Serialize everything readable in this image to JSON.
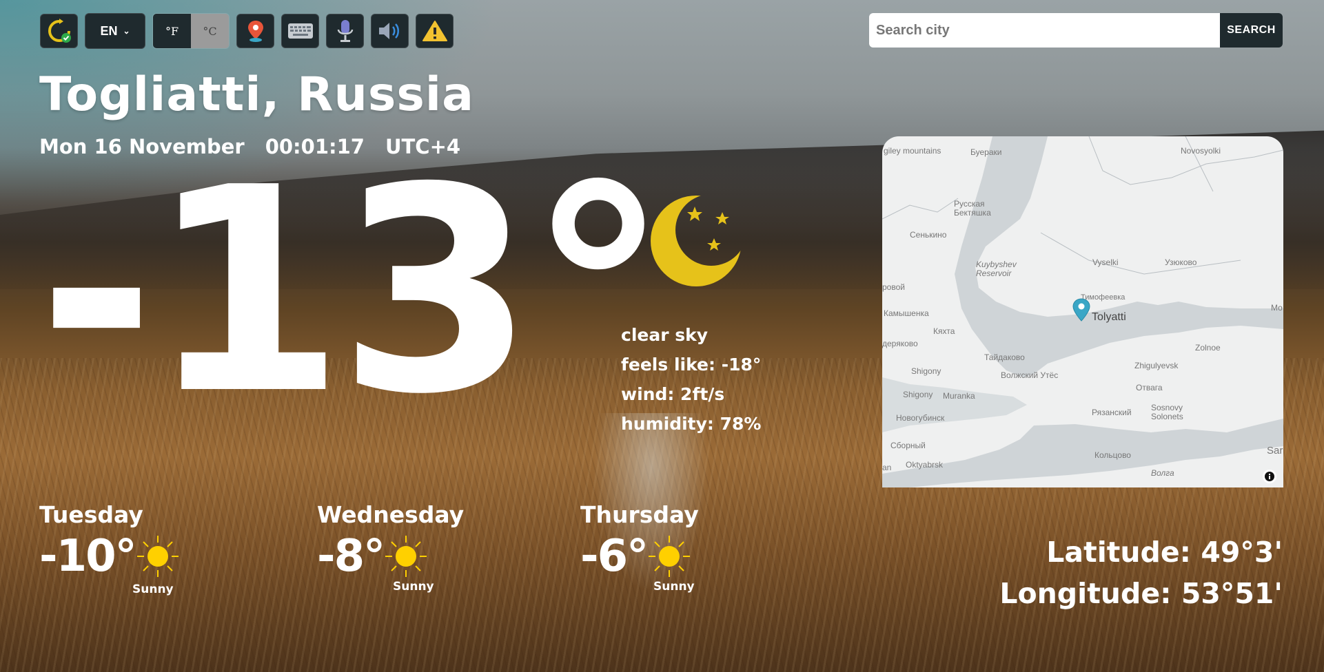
{
  "toolbar": {
    "language": "EN",
    "unit_f": "°F",
    "unit_c": "°C",
    "icons": [
      "refresh-icon",
      "location-pin-icon",
      "keyboard-icon",
      "microphone-icon",
      "volume-icon",
      "warning-icon"
    ]
  },
  "search": {
    "placeholder": "Search city",
    "button_label": "SEARCH"
  },
  "location": {
    "title": "Togliatti, Russia",
    "date": "Mon 16 November",
    "time": "00:01:17",
    "timezone": "UTC+4"
  },
  "current": {
    "temperature": "-13°",
    "condition": "clear sky",
    "feels_like": "feels like: -18°",
    "wind": "wind: 2ft/s",
    "humidity": "humidity: 78%",
    "icon": "moon-stars-icon"
  },
  "map": {
    "marker_label": "Tolyatti",
    "labels": [
      "giley mountains",
      "Буераки",
      "Novosyolki",
      "Русская Бектяшка",
      "Сенькино",
      "Kuybyshev Reservoir",
      "Vyselki",
      "Узюково",
      "Тимофеевка",
      "ровой",
      "Камышенка",
      "Кяхта",
      "деряково",
      "Тайдаково",
      "Zhigulyevsk",
      "Zolnoe",
      "Shigony",
      "Волжский Утёс",
      "Отвага",
      "Shigony",
      "Muranka",
      "Рязанский",
      "Sosnovy Solonets",
      "Новогубинск",
      "Сборный",
      "Кольцово",
      "Oktyabrsk",
      "Волга",
      "Sar",
      "Мо",
      "an"
    ]
  },
  "forecast": [
    {
      "day": "Tuesday",
      "temp": "-10°",
      "desc": "Sunny",
      "icon": "sun-icon"
    },
    {
      "day": "Wednesday",
      "temp": "-8°",
      "desc": "Sunny",
      "icon": "sun-icon"
    },
    {
      "day": "Thursday",
      "temp": "-6°",
      "desc": "Sunny",
      "icon": "sun-icon"
    }
  ],
  "coordinates": {
    "latitude": "Latitude: 49°3'",
    "longitude": "Longitude: 53°51'"
  },
  "colors": {
    "button_bg": "#1f2a2e",
    "moon": "#e6c21a",
    "sun": "#ffd000",
    "map_pin": "#3aa6c6"
  }
}
